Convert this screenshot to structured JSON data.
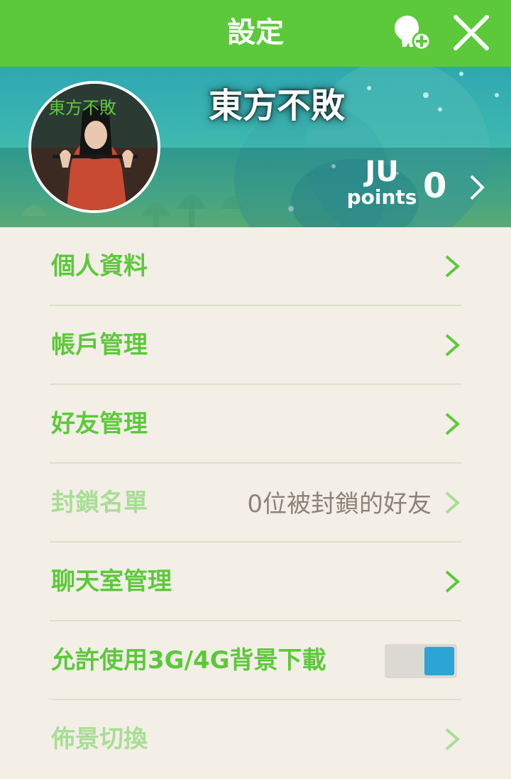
{
  "header": {
    "title": "設定",
    "add_friend_icon": "add-friend-icon",
    "close_icon": "close-icon",
    "accent_color": "#5cc93a"
  },
  "profile": {
    "avatar_caption": "東方不敗",
    "name": "東方不敗",
    "points_label_top": "JU",
    "points_label_bottom": "points",
    "points_value": "0"
  },
  "menu": {
    "items": [
      {
        "label": "個人資料",
        "value": "",
        "enabled": true
      },
      {
        "label": "帳戶管理",
        "value": "",
        "enabled": true
      },
      {
        "label": "好友管理",
        "value": "",
        "enabled": true
      },
      {
        "label": "封鎖名單",
        "value": "0位被封鎖的好友",
        "enabled": false
      },
      {
        "label": "聊天室管理",
        "value": "",
        "enabled": true
      },
      {
        "label": "允許使用3G/4G背景下載",
        "toggle_on": true,
        "toggle_color": "#2aa5d6"
      },
      {
        "label": "佈景切換",
        "value": "",
        "enabled": false
      }
    ]
  }
}
